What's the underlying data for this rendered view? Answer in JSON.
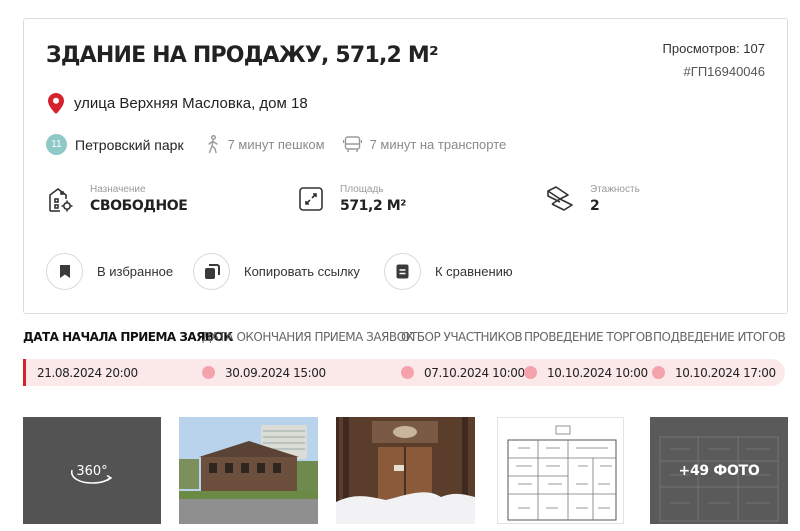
{
  "listing": {
    "title": "ЗДАНИЕ НА ПРОДАЖУ, 571,2 М²",
    "views_label": "Просмотров:",
    "views_count": "107",
    "lot_id": "#ГП16940046",
    "address": "улица Верхняя Масловка, дом 18",
    "metro": {
      "line_number": "11",
      "line_color": "#8ec8c7",
      "station": "Петровский парк",
      "walk": "7 минут пешком",
      "transport": "7 минут на транспорте"
    },
    "features": [
      {
        "icon": "building-icon",
        "label": "Назначение",
        "value": "СВОБОДНОЕ"
      },
      {
        "icon": "area-icon",
        "label": "Площадь",
        "value": "571,2 М²"
      },
      {
        "icon": "stairs-icon",
        "label": "Этажность",
        "value": "2"
      }
    ],
    "actions": [
      {
        "icon": "bookmark-icon",
        "label": "В избранное"
      },
      {
        "icon": "copy-icon",
        "label": "Копировать ссылку"
      },
      {
        "icon": "compare-icon",
        "label": "К сравнению"
      }
    ]
  },
  "auction": {
    "accent_color": "#d6212f",
    "stages": [
      {
        "label": "ДАТА НАЧАЛА ПРИЕМА ЗАЯВОК",
        "date": "21.08.2024 20:00",
        "active": true
      },
      {
        "label": "ДАТА ОКОНЧАНИЯ ПРИЕМА ЗАЯВОК",
        "date": "30.09.2024 15:00",
        "active": false
      },
      {
        "label": "ОТБОР УЧАСТНИКОВ",
        "date": "07.10.2024 10:00",
        "active": false
      },
      {
        "label": "ПРОВЕДЕНИЕ ТОРГОВ",
        "date": "10.10.2024 10:00",
        "active": false
      },
      {
        "label": "ПОДВЕДЕНИЕ ИТОГОВ",
        "date": "10.10.2024 17:00",
        "active": false
      }
    ]
  },
  "gallery": {
    "tour_label": "360°",
    "more_photos": "+49 ФОТО"
  }
}
